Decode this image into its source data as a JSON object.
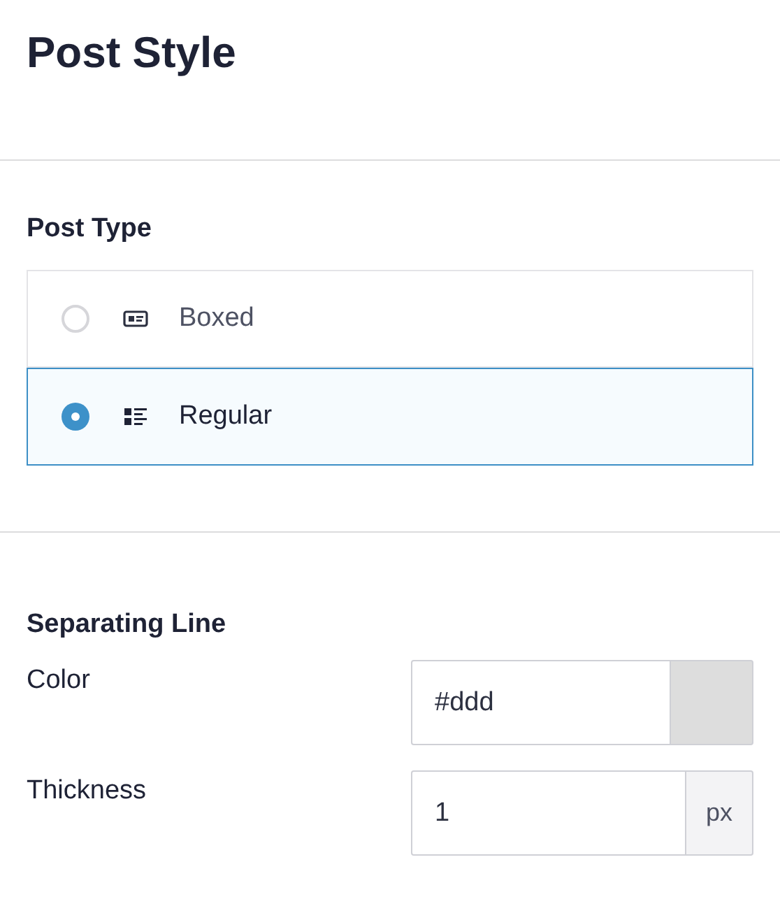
{
  "title": "Post Style",
  "post_type": {
    "heading": "Post Type",
    "options": [
      {
        "label": "Boxed",
        "kind": "boxed",
        "selected": false
      },
      {
        "label": "Regular",
        "kind": "regular",
        "selected": true
      }
    ]
  },
  "separating_line": {
    "heading": "Separating Line",
    "color": {
      "label": "Color",
      "value": "#ddd",
      "color": "#dddddd"
    },
    "thickness": {
      "label": "Thickness",
      "value": "1",
      "unit": "px"
    }
  }
}
